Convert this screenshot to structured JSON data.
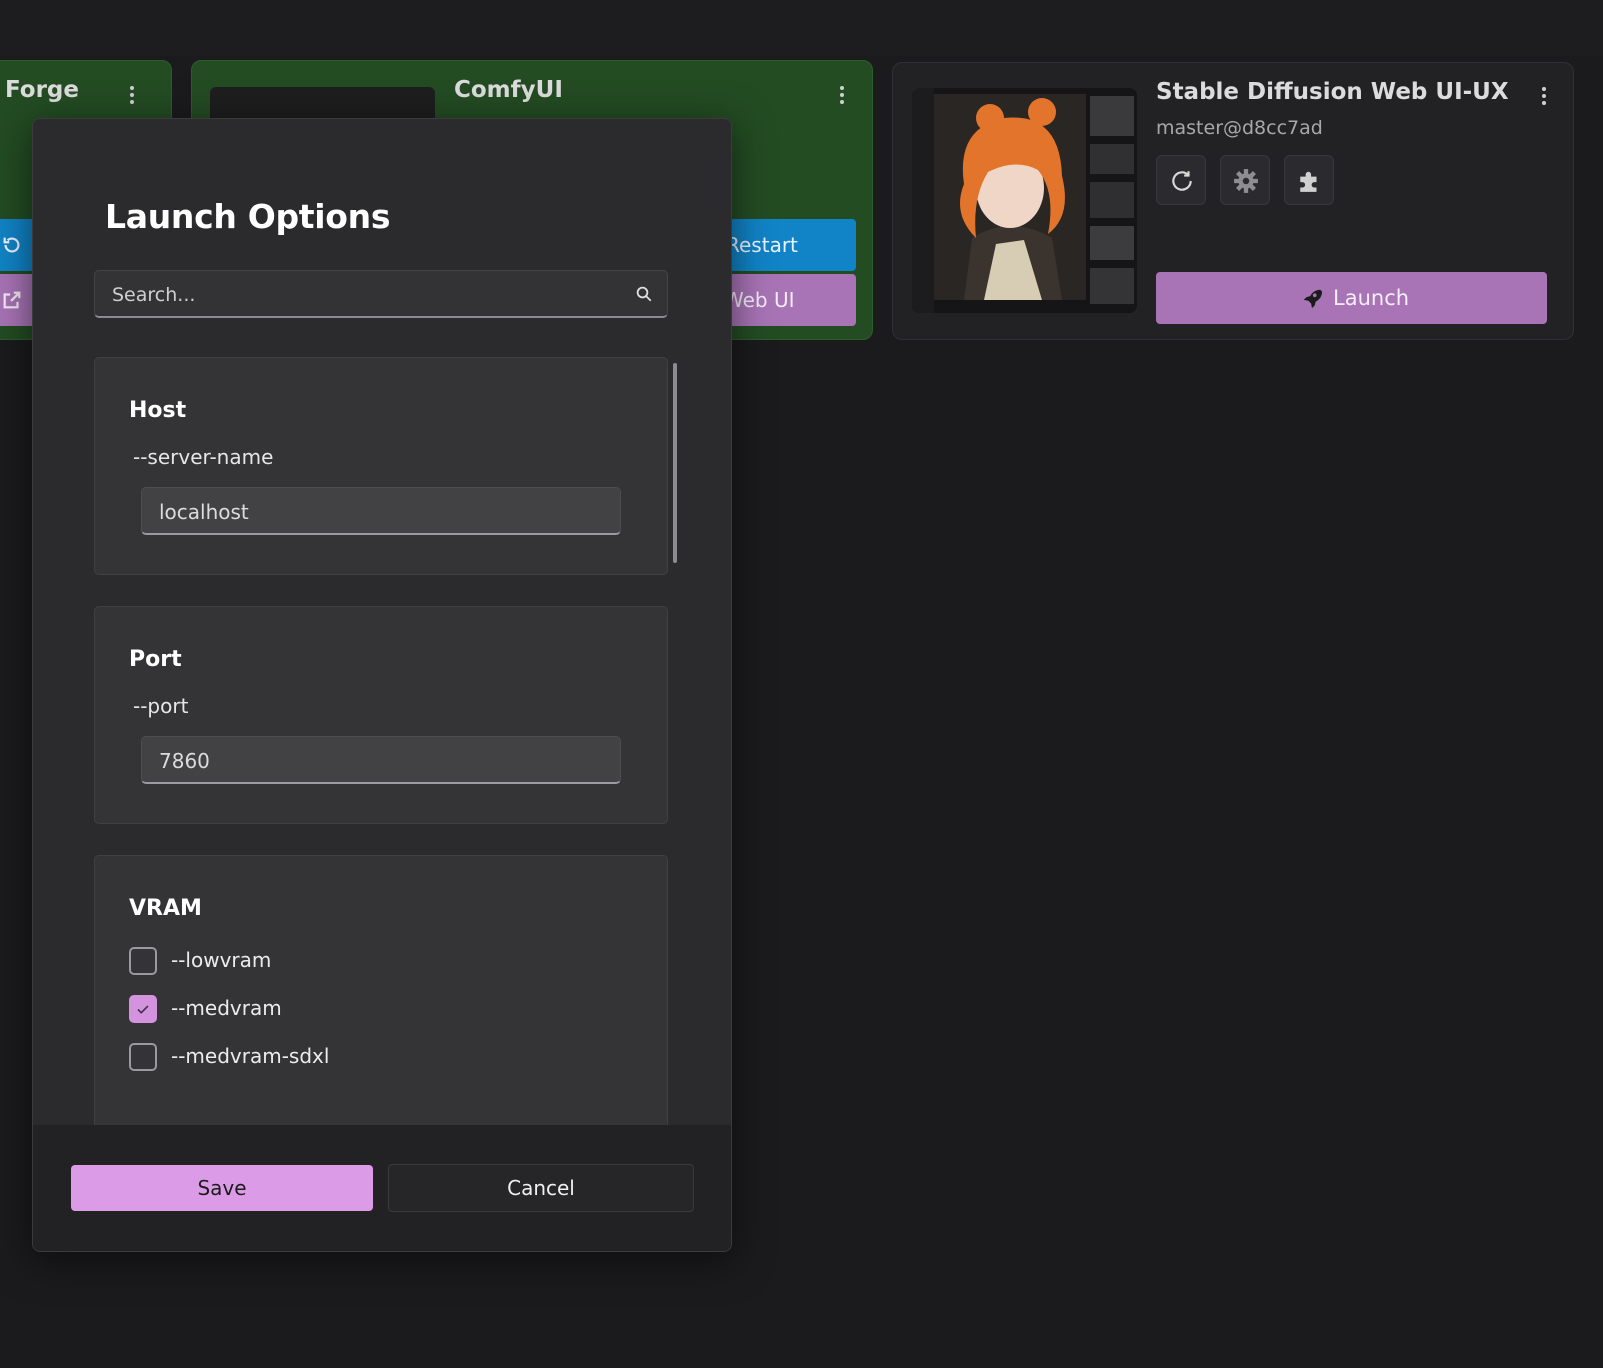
{
  "cards": {
    "forge": {
      "title": "Forge"
    },
    "comfyui": {
      "title": "ComfyUI",
      "restart_label": "Restart",
      "webui_label": "Web UI"
    },
    "sdux": {
      "title": "Stable Diffusion Web UI-UX",
      "version": "master@d8cc7ad",
      "launch_label": "Launch"
    }
  },
  "dialog": {
    "title": "Launch Options",
    "search_placeholder": "Search...",
    "sections": {
      "host": {
        "title": "Host",
        "arg": "--server-name",
        "value": "localhost"
      },
      "port": {
        "title": "Port",
        "arg": "--port",
        "value": "7860"
      },
      "vram": {
        "title": "VRAM",
        "options": [
          {
            "label": "--lowvram",
            "checked": false
          },
          {
            "label": "--medvram",
            "checked": true
          },
          {
            "label": "--medvram-sdxl",
            "checked": false
          }
        ]
      }
    },
    "save_label": "Save",
    "cancel_label": "Cancel"
  },
  "colors": {
    "accent": "#dc9be6",
    "card_green": "#234c23",
    "restart_blue": "#1184c7",
    "launch_violet": "#a874b6"
  }
}
